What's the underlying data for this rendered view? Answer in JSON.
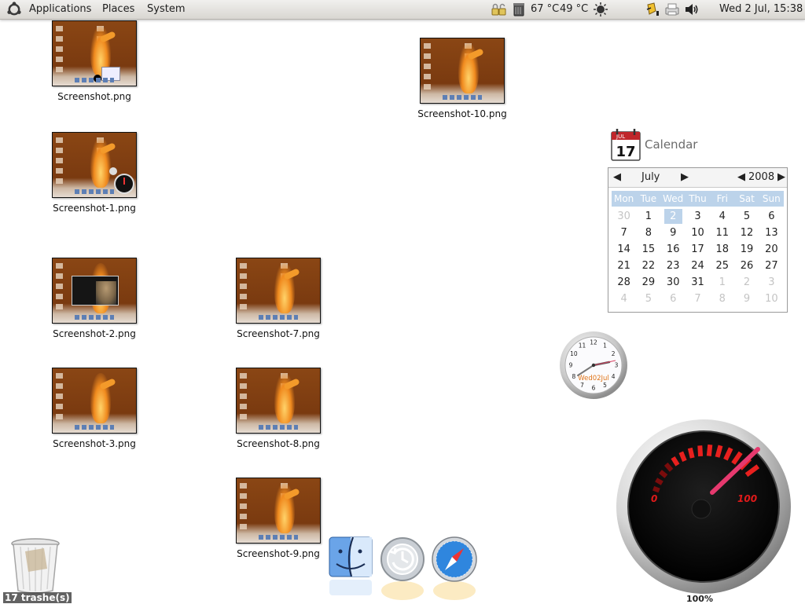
{
  "panel": {
    "menus": [
      "Applications",
      "Places",
      "System"
    ],
    "temp1": "67 °C",
    "temp2": "49 °C",
    "clock": "Wed  2 Jul, 15:38"
  },
  "desktop_icons": [
    {
      "label": "Screenshot.png"
    },
    {
      "label": "Screenshot-1.png"
    },
    {
      "label": "Screenshot-2.png"
    },
    {
      "label": "Screenshot-3.png"
    },
    {
      "label": "Screenshot-7.png"
    },
    {
      "label": "Screenshot-8.png"
    },
    {
      "label": "Screenshot-9.png"
    },
    {
      "label": "Screenshot-10.png"
    }
  ],
  "calendar": {
    "icon_day": "17",
    "icon_month": "JUL",
    "title": "Calendar",
    "month": "July",
    "year": "2008",
    "weekdays": [
      "Mon",
      "Tue",
      "Wed",
      "Thu",
      "Fri",
      "Sat",
      "Sun"
    ],
    "days": [
      [
        "30",
        "1",
        "2",
        "3",
        "4",
        "5",
        "6"
      ],
      [
        "7",
        "8",
        "9",
        "10",
        "11",
        "12",
        "13"
      ],
      [
        "14",
        "15",
        "16",
        "17",
        "18",
        "19",
        "20"
      ],
      [
        "21",
        "22",
        "23",
        "24",
        "25",
        "26",
        "27"
      ],
      [
        "28",
        "29",
        "30",
        "31",
        "1",
        "2",
        "3"
      ],
      [
        "4",
        "5",
        "6",
        "7",
        "8",
        "9",
        "10"
      ]
    ],
    "selected_day": "2"
  },
  "clock_widget": {
    "date_text": "Wed02Jul",
    "numerals": [
      "12",
      "1",
      "2",
      "3",
      "4",
      "5",
      "6",
      "7",
      "8",
      "9",
      "10",
      "11"
    ]
  },
  "gauge": {
    "min_label": "0",
    "max_label": "100",
    "value_percent": 100,
    "value_label": "100%"
  },
  "trash": {
    "label": "17 trashe(s)"
  },
  "dock": [
    "finder-icon",
    "time-machine-icon",
    "safari-icon"
  ]
}
